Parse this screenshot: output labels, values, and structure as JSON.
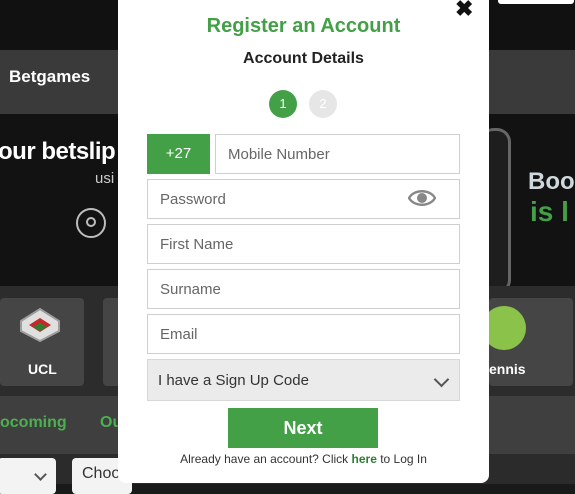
{
  "background": {
    "brand": "Betgames",
    "banner_left_text": "our betslip",
    "banner_left_sub": "usi",
    "banner_right_line1": "Boo",
    "banner_right_line2": "is l",
    "sports": [
      {
        "label": "UCL",
        "icon": "ucl-badge-icon"
      },
      {
        "label": "ennis",
        "icon": "tennis-ball-icon"
      }
    ],
    "tabs": [
      "ocoming",
      "Ou"
    ],
    "select_right": "Choo"
  },
  "modal": {
    "title": "Register an Account",
    "subtitle": "Account Details",
    "steps": [
      "1",
      "2"
    ],
    "country_code": "+27",
    "mobile_placeholder": "Mobile Number",
    "password_placeholder": "Password",
    "first_name_placeholder": "First Name",
    "surname_placeholder": "Surname",
    "email_placeholder": "Email",
    "signup_code_option": "I have a Sign Up Code",
    "next_label": "Next",
    "login_prefix": "Already have an account? Click ",
    "login_link": "here",
    "login_suffix": " to Log In",
    "close_symbol": "✖"
  },
  "colors": {
    "accent": "#43a047",
    "dark_bg": "#1a1a1a"
  }
}
